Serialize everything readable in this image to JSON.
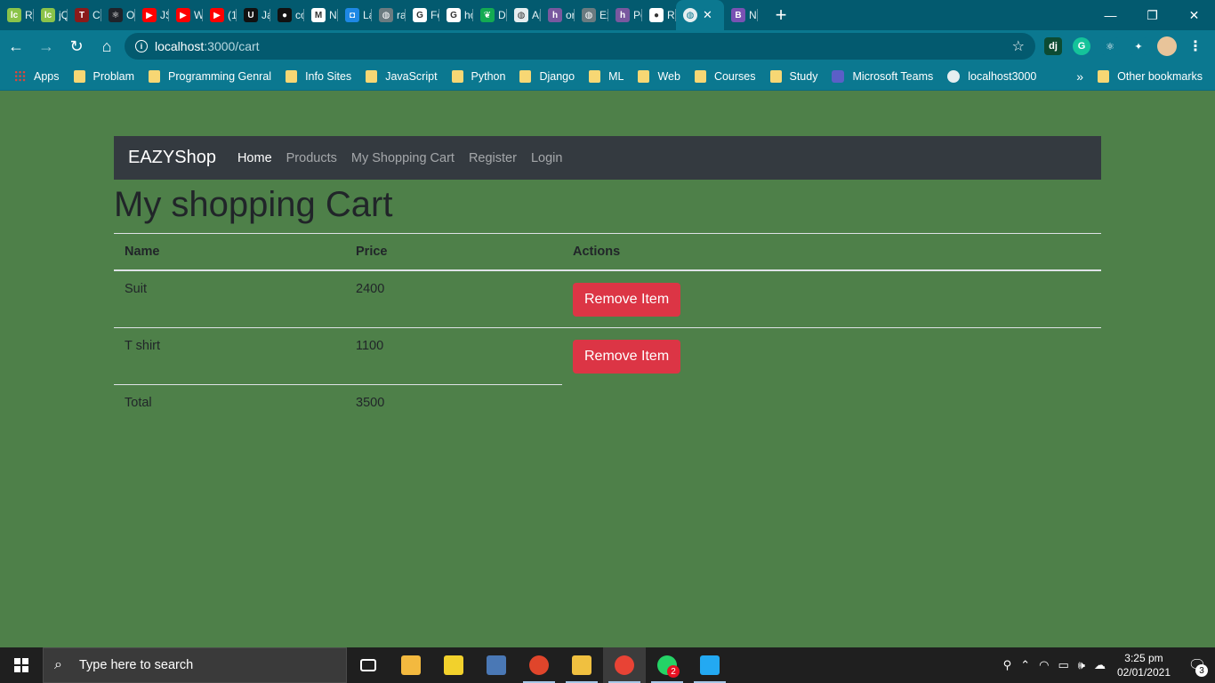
{
  "browser": {
    "tabs": [
      {
        "title": "Re",
        "icon": "leetcode-icon",
        "color": "#8bc34a",
        "glyph": "lc"
      },
      {
        "title": "jQ",
        "icon": "leetcode-icon",
        "color": "#8bc34a",
        "glyph": "lc"
      },
      {
        "title": "Cc",
        "icon": "tools-icon",
        "color": "#8b1a1a",
        "glyph": "T"
      },
      {
        "title": "Oj",
        "icon": "react-icon",
        "color": "#20232a",
        "glyph": "⚛"
      },
      {
        "title": "JS",
        "icon": "youtube-icon",
        "color": "#ff0000",
        "glyph": "▶"
      },
      {
        "title": "W",
        "icon": "youtube-icon",
        "color": "#ff0000",
        "glyph": "▶"
      },
      {
        "title": "(1)",
        "icon": "youtube-icon",
        "color": "#ff0000",
        "glyph": "▶"
      },
      {
        "title": "Ja",
        "icon": "udemy-icon",
        "color": "#111111",
        "glyph": "U"
      },
      {
        "title": "co",
        "icon": "codechef-icon",
        "color": "#111111",
        "glyph": "●"
      },
      {
        "title": "Ne",
        "icon": "gmail-icon",
        "color": "#ffffff",
        "glyph": "M"
      },
      {
        "title": "La",
        "icon": "classroom-icon",
        "color": "#1e88e5",
        "glyph": "◘"
      },
      {
        "title": "ra",
        "icon": "globe-icon",
        "color": "#6b7b80",
        "glyph": "◍"
      },
      {
        "title": "Fo",
        "icon": "google-icon",
        "color": "#ffffff",
        "glyph": "G"
      },
      {
        "title": "ho",
        "icon": "google-icon",
        "color": "#ffffff",
        "glyph": "G"
      },
      {
        "title": "Da",
        "icon": "mongodb-icon",
        "color": "#13aa52",
        "glyph": "❦"
      },
      {
        "title": "Ap",
        "icon": "globe-icon",
        "color": "#e6eef0",
        "glyph": "◍"
      },
      {
        "title": "or",
        "icon": "heroku-icon",
        "color": "#79589f",
        "glyph": "h"
      },
      {
        "title": "Ex",
        "icon": "globe-icon",
        "color": "#6b7b80",
        "glyph": "◍"
      },
      {
        "title": "Pe",
        "icon": "heroku-icon",
        "color": "#79589f",
        "glyph": "h"
      },
      {
        "title": "Re",
        "icon": "github-icon",
        "color": "#ffffff",
        "glyph": "●"
      }
    ],
    "active_tab": {
      "title": "",
      "icon": "globe-icon"
    },
    "trailing_tab": {
      "title": "N:",
      "icon": "bootstrap-icon",
      "color": "#7952b3",
      "glyph": "B"
    },
    "new_tab_label": "+",
    "window_controls": {
      "minimize": "—",
      "restore": "❐",
      "close": "✕"
    },
    "address": {
      "host": "localhost",
      "path": ":3000/cart"
    },
    "extensions": [
      {
        "icon": "django-icon",
        "label": "dj",
        "color": "#0c4b33"
      },
      {
        "icon": "grammarly-icon",
        "label": "G",
        "color": "#15c39a"
      },
      {
        "icon": "react-devtools-icon",
        "label": "⚛",
        "color": "#0b7890"
      },
      {
        "icon": "puzzle-icon",
        "label": "✦",
        "color": "#0b7890"
      }
    ],
    "bookmarks": [
      {
        "label": "Apps",
        "kind": "grid"
      },
      {
        "label": "Problam",
        "kind": "folder"
      },
      {
        "label": "Programming Genral",
        "kind": "folder"
      },
      {
        "label": "Info Sites",
        "kind": "folder"
      },
      {
        "label": "JavaScript",
        "kind": "folder"
      },
      {
        "label": "Python",
        "kind": "folder"
      },
      {
        "label": "Django",
        "kind": "folder"
      },
      {
        "label": "ML",
        "kind": "folder"
      },
      {
        "label": "Web",
        "kind": "folder"
      },
      {
        "label": "Courses",
        "kind": "folder"
      },
      {
        "label": "Study",
        "kind": "folder"
      },
      {
        "label": "Microsoft Teams",
        "kind": "teams"
      },
      {
        "label": "localhost3000",
        "kind": "globe"
      }
    ],
    "bookmarks_more": "»",
    "other_bookmarks": "Other bookmarks"
  },
  "app": {
    "brand": "EAZYShop",
    "nav": [
      {
        "label": "Home",
        "active": true
      },
      {
        "label": "Products",
        "active": false
      },
      {
        "label": "My Shopping Cart",
        "active": false
      },
      {
        "label": "Register",
        "active": false
      },
      {
        "label": "Login",
        "active": false
      }
    ],
    "page_title": "My shopping Cart",
    "columns": {
      "name": "Name",
      "price": "Price",
      "actions": "Actions"
    },
    "items": [
      {
        "name": "Suit",
        "price": "2400",
        "action": "Remove Item"
      },
      {
        "name": "T shirt",
        "price": "1100",
        "action": "Remove Item"
      }
    ],
    "total": {
      "label": "Total",
      "value": "3500"
    },
    "colors": {
      "page_bg": "#4e8049",
      "navbar_bg": "#343a40",
      "danger": "#dc3545"
    }
  },
  "taskbar": {
    "search_placeholder": "Type here to search",
    "apps": [
      {
        "icon": "task-view-icon",
        "color": "#1f1f1f",
        "running": false
      },
      {
        "icon": "store-icon",
        "color": "#f3b93f",
        "running": false
      },
      {
        "icon": "help-icon",
        "color": "#f2d12c",
        "running": false
      },
      {
        "icon": "python-installer-icon",
        "color": "#4a78b5",
        "running": false
      },
      {
        "icon": "browser-icon",
        "color": "#e0452b",
        "running": true
      },
      {
        "icon": "file-explorer-icon",
        "color": "#f0c040",
        "running": true
      },
      {
        "icon": "chrome-icon",
        "color": "#e84335",
        "running": true
      },
      {
        "icon": "whatsapp-icon",
        "color": "#25d366",
        "running": true
      },
      {
        "icon": "vscode-icon",
        "color": "#23a9f2",
        "running": true
      }
    ],
    "whatsapp_badge": "2",
    "clock": {
      "time": "3:25 pm",
      "date": "02/01/2021"
    },
    "notification_count": "3"
  }
}
